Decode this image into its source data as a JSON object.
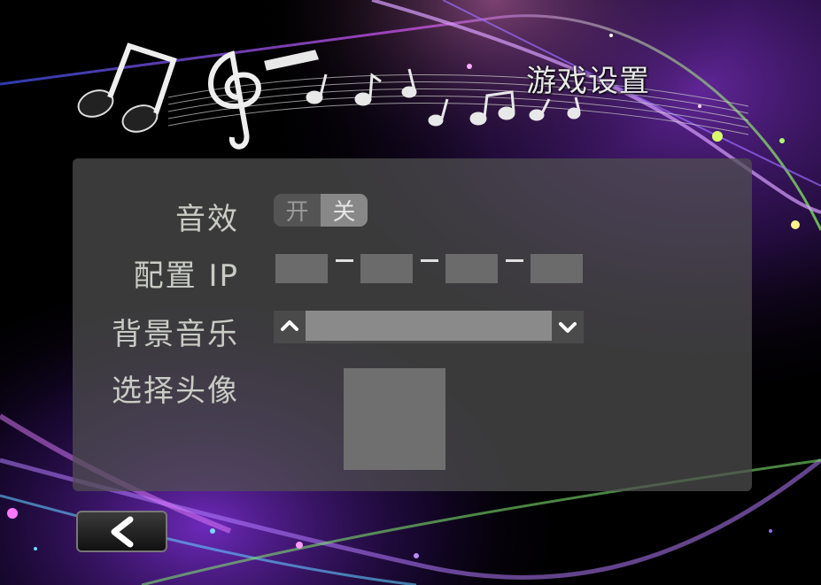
{
  "header": {
    "title": "游戏设置"
  },
  "settings": {
    "sound_label": "音效",
    "sound_on": "开",
    "sound_off": "关",
    "ip_label": "配置 IP",
    "music_label": "背景音乐",
    "music_value": "",
    "avatar_label": "选择头像"
  },
  "colors": {
    "panel": "#505050",
    "label": "#c9ccc5",
    "toggle_selected": "#888888"
  },
  "icons": {
    "back": "back-arrow-icon",
    "up": "chevron-up-icon",
    "down": "chevron-down-icon"
  }
}
